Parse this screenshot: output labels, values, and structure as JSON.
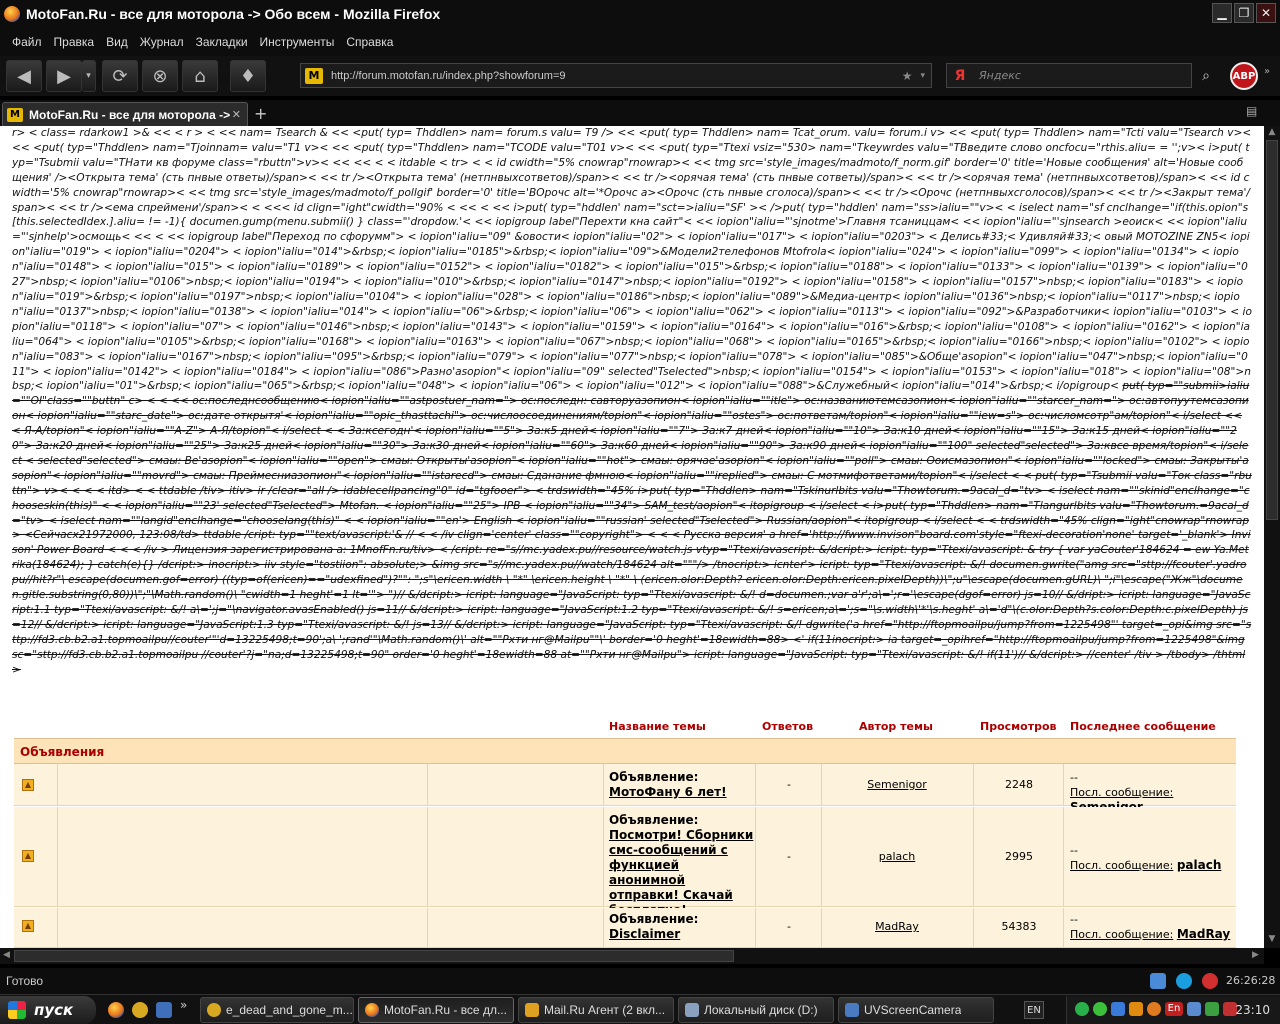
{
  "window": {
    "title": "MotoFan.Ru - все для моторола -> Обо всем - Mozilla Firefox",
    "min_glyph": "▁",
    "max_glyph": "❐",
    "close_glyph": "✕"
  },
  "menu": [
    "Файл",
    "Правка",
    "Вид",
    "Журнал",
    "Закладки",
    "Инструменты",
    "Справка"
  ],
  "toolbar": {
    "back_glyph": "◀",
    "forward_glyph": "▶",
    "history_glyph": "▾",
    "reload_glyph": "⟳",
    "stop_glyph": "⊗",
    "home_glyph": "⌂",
    "addon_glyph": "♦",
    "url": "http://forum.motofan.ru/index.php?showforum=9",
    "site_icon_letter": "M",
    "star_glyph": "★",
    "drop_glyph": "▾",
    "search_engine_letter": "Я",
    "search_placeholder": "Яндекс",
    "search_go_glyph": "⌕",
    "abp_label": "ABP",
    "overflow_glyph": "»"
  },
  "tabs": {
    "active_label": "MotoFan.Ru - все для моторола -> Об...",
    "close_glyph": "✕",
    "new_tab_glyph": "+",
    "list_glyph": "▤"
  },
  "garbage": {
    "plain": "r> < class= rdarkow1 >& << < r > < << nam= Tsearch & << <put( typ= Thddlen> nam= forum.s valu= T9 /> << <put( typ= Thddlen> nam= Tcat_orum. valu= forum.i v> << <put( typ= Thddlen> nam=\"Tcti valu=\"Tsearch v>< << <put( typ=\"Thddlen> nam=\"Tjoinnam= valu=\"T1 v>< << <put( typ=\"Thddlen> nam=\"TCODE valu=\"T01 v>< << <put( typ=\"Ttexi vsiz=\"530> nam=\"Tkeywrdes valu=\"TВведите слово oncfocu=\"rthis.aliu= = '';v>< i>put( typ=\"Tsubmii valu=\"TНати кв форуме class=\"rbuttn\">v>< << << < < itdable < tr> < < id cwidth=\"5% cnowrap\"rnowrap>< << tmg src='style_images/madmoto/f_norm.gif' border='0' title='Новые сообщения' alt='Новые сообщения' /><Открыта тема' (сть пнвые ответы)/span>< << tr /><Открыта тема' (нетпнвыхсответов)/span>< << tr /><орячая тема' (сть пнвые сответы)/span>< << tr /><орячая тема' (нетпнвыхсответов)/span>< << id cwidth='5% cnowrap\"rnowrap>< << tmg src='style_images/madmoto/f_pollgif' border='0' title='ВОрочс alt='*Орочс а><Орочс (сть пнвые сголоса)/span>< << tr /><Орочс (нетпнвыхсголосов)/span>< << tr /><Закрыт тема'/span>< << tr /><ема спреймени'/span>< < <<< id clign=\"ight\"cwidth=\"90% < << < << i>put( typ=\"hddlen' nam=\"sct=>ialiu=\"SF' >< />put( typ=\"hddlen' nam=\"ss>ialiu=\"\"v>< < iselect nam=\"sf cnclhange=\"if(this.opion\"s[this.selectedIdex.].aliu= != -1){ documen.gump(menu.submii() } class=\"'dropdow.'< << iopigroup label\"Перехти кна сайт\"< << iopion\"ialiu=\"'sjnotme'>Главня тсаниццам< << iopion\"ialiu=\"'sjnsearch >еоиск< << iopion\"ialiu=\"'sjnhelp'>осмощь< << < << iopigroup label\"Переход по сфорумм\"> < iopion\"ialiu=\"09\" &овости< iopion\"ialiu=\"02\"> < iopion\"ialiu=\"017\"> < iopion\"ialiu=\"0203\"> < Делись#33;< Удивляй#33;< овый MOTOZINE ZN5< iopion\"ialiu=\"019\"> < iopion\"ialiu=\"0204\"> < iopion\"ialiu=\"014\">&rbsp;< iopion\"ialiu=\"0185\">&rbsp;< iopion\"ialiu=\"09\">&Модели2телефонов Mtofrola< iopion\"ialiu=\"024\"> < iopion\"ialiu=\"099\"> < iopion\"ialiu=\"0134\"> < iopion\"ialiu=\"0148\"> < iopion\"ialiu=\"015\"> < iopion\"ialiu=\"0189\"> < iopion\"ialiu=\"0152\"> < iopion\"ialiu=\"0182\"> < iopion\"ialiu=\"015\">&rbsp;< iopion\"ialiu=\"0188\"> < iopion\"ialiu=\"0133\"> < iopion\"ialiu=\"0139\"> < iopion\"ialiu=\"027\">nbsp;< iopion\"ialiu=\"0106\">nbsp;< iopion\"ialiu=\"0194\"> < iopion\"ialiu=\"010\">&rbsp;< iopion\"ialiu=\"0147\">nbsp;< iopion\"ialiu=\"0192\"> < iopion\"ialiu=\"0158\"> < iopion\"ialiu=\"0157\">nbsp;< iopion\"ialiu=\"0183\"> < iopion\"ialiu=\"019\">&rbsp;< iopion\"ialiu=\"0197\">nbsp;< iopion\"ialiu=\"0104\"> < iopion\"ialiu=\"028\"> < iopion\"ialiu=\"0186\">nbsp;< iopion\"ialiu=\"089\">&Медиа-центр< iopion\"ialiu=\"0136\">nbsp;< iopion\"ialiu=\"0117\">nbsp;< iopion\"ialiu=\"0137\">nbsp;< iopion\"ialiu=\"0138\"> < iopion\"ialiu=\"014\"> < iopion\"ialiu=\"06\">&rbsp;< iopion\"ialiu=\"06\"> < iopion\"ialiu=\"062\"> < iopion\"ialiu=\"0113\"> < iopion\"ialiu=\"092\">&Разработчики< iopion\"ialiu=\"0103\"> < iopion\"ialiu=\"0118\"> < iopion\"ialiu=\"07\"> < iopion\"ialiu=\"0146\">nbsp;< iopion\"ialiu=\"0143\"> < iopion\"ialiu=\"0159\"> < iopion\"ialiu=\"0164\"> < iopion\"ialiu=\"016\">&rbsp;< iopion\"ialiu=\"0108\"> < iopion\"ialiu=\"0162\"> < iopion\"ialiu=\"064\"> < iopion\"ialiu=\"0105\">&rbsp;< iopion\"ialiu=\"0168\"> < iopion\"ialiu=\"0163\"> < iopion\"ialiu=\"067\">nbsp;< iopion\"ialiu=\"068\"> < iopion\"ialiu=\"0165\">&rbsp;< iopion\"ialiu=\"0166\">nbsp;< iopion\"ialiu=\"0102\"> < iopion\"ialiu=\"083\"> < iopion\"ialiu=\"0167\">nbsp;< iopion\"ialiu=\"095\">&rbsp;< iopion\"ialiu=\"079\"> < iopion\"ialiu=\"077\">nbsp;< iopion\"ialiu=\"078\"> < iopion\"ialiu=\"085\">&Обще'asopion\"< iopion\"ialiu=\"047\">nbsp;< iopion\"ialiu=\"011\"> < iopion\"ialiu=\"0142\"> < iopion\"ialiu=\"0184\"> < iopion\"ialiu=\"086\">Разно'asopion\"< iopion\"ialiu=\"09\" selected\"Tselected\">nbsp;< iopion\"ialiu=\"0154\"> < iopion\"ialiu=\"0153\"> < iopion\"ialiu=\"018\"> < iopion\"ialiu=\"08\">nbsp;< iopion\"ialiu=\"01\">&rbsp;< iopion\"ialiu=\"065\">&rbsp;< iopion\"ialiu=\"048\"> < iopion\"ialiu=\"06\"> < iopion\"ialiu=\"012\"> < iopion\"ialiu=\"088\">&Служебный< iopion\"ialiu=\"014\">&rbsp;< i/opigroup< ",
    "struck": "put( typ=\"\"submii>ialiu=\"\"OI\"class=\"\"buttn\" c> < < << ос:последнсообщению< iopion\"ialiu=\"\"astpostuer_nam=\"> ос:последн: савторуазопион< iopion\"ialiu=\"\"itle\"> ос:названиютемсазопион< iopion\"ialiu=\"\"starcer_nam=\"> ос:автопуутемсазопион< iopion\"ialiu=\"\"starc_date\"> ос:дате открытя'< iopion\"ialiu=\"\"opic_thasttachi\"> ос:числоосоединениям/topion\"< iopion\"ialiu=\"\"ostes\"> ос:пответам/topion\"< iopion\"ialiu=\"\"iew=s\"> ос:числомсотр\"ам/topion\"< i/select << < Я-А/topion\"< iopion\"ialiu=\"\"A-Z\"> А-Я/topion\"< i/select < < За:ксегодн'< iopion\"ialiu=\"\"5\"> За:к5 дней< iopion\"ialiu=\"\"7\"> За:к7 дней< iopion\"ialiu=\"\"10\"> За:к10 дней< iopion\"ialiu=\"\"15\"> За:к15 дней< iopion\"ialiu=\"\"20\"> За:к20 дней< iopion\"ialiu=\"\"25\"> За:к25 дней< iopion\"ialiu=\"\"30\"> За:к30 дней< iopion\"ialiu=\"\"60\"> За:к60 дней< iopion\"ialiu=\"\"90\"> За:к90 дней< iopion\"ialiu=\"\"100\" selected\"selected\"> За:квсе время/topion\"< i/select < selected\"selected\"> смаы: Ве'asopion\"< iopion\"ialiu=\"\"open\"> смаы: Открыты'asopion\"< iopion\"ialiu=\"\"hot\"> смаы: орячае'asopion\"< iopion\"ialiu=\"\"poll\"> смаы: Ооисмазопион\"< iopion\"ialiu=\"\"locked\"> смаы: Закрыты'asopion\"< iopion\"ialiu=\"\"movrd\"> смаы: Преймесниазопион\"< iopion\"ialiu=\"\"istarecd\"> смаы: Сданание фмною< iopion\"ialiu=\"\"ireplied\"> смаы: С мотмифответами/topion\"< i/select < < put( typ=\"Tsubmii valu=\"Ток class=\"rbuttn\"> v>< < < < itd> < < ttdable /tiv> itiv> ir /clear=\"all /> idablecellpancing\"0\" id=\"tgfooer\"> < trdswidth=\"45% i>put( typ=\"Thddlen> nam=\"Tskinurlbits valu=\"Thowtorum.=9acal_d=\"tv> < iselect nam=\"\"skinid\"enclhange=\"chooseskin(this)\" < < iopion\"ialiu=\"\"23' selected\"Tselected\"> Mtofan. < iopion\"ialiu=\"\"25\"> IPB < iopion\"ialiu=\"\"34\"> SAM_test/aopion\"< itopigroup < i/select < i>put( typ=\"Thddlen> nam=\"Tlangurlbits valu=\"Thowtorum.=9acal_d=\"tv> < iselect nam=\"\"langid\"enclhange=\"chooselang(this)\" < < iopion\"ialiu=\"\"en'> English < iopion\"ialiu=\"\"russian' selected\"Tselected\"> Russian/aopion\"< itopigroup < i/select < < trdswidth=\"45% clign=\"ight\"cnowrap\"rnowrap> <Сейчасх21972000, 123:08/td> ttdable /cript: typ=\"\"text/avascript:'& // < < /iv clign='center' class=\"\"copyright\"> < < < Русска версия' a href='http://fwww.invison\"board.com'style=\"ftexi-decoration'none' target='_blank'> Invison' Power Board < < < /iv > Лицензия зарегистрирована а: 1MnofFn.ru/tiv> < /cript: re=\"s//mc.yadex.pu//resource/watch.js vtyp=\"Ttexi/avascript: &/dcript:> icript: typ=\"Ttexi/avascript: & try { var yaCouter'184624 = ew Ya.Metrika(184624); } catch(e){} /dcript:> inocript:> iiv style=\"tostiion\": absolute;> &img src=\"s//mc.yadex.pu//watch/184624 alt=\"\"\"/> /tnocript:> icnter'> icript: typ=\"Ttexi/avascript: &/! documen.gwrite(\"amg src=\"sttp://fcouter'.yadropu//hit?r\"\\ escape(documen.gof=error) ((typ=of(ericen)==\"udexfined\")?\"\": \";s\"\\ericen.width \\ \"*\" \\ericen.height \\ \"*\" \\ (ericen.olor:Depth? ericen.olor:Depth:ericen.pixelDepth))\\\";u\"\\escape(documen.gURL)\\ \";i\"\\escape(\"Жж\"\\documen.gitle.substring(0,80))\\\";\"\\Math.random()\\ \"cwidth=1 heght'=1 lt='\"> \")//  &/dcript:> icript: language=\"JavaScript: typ=\"Ttexi/avascript: &/! d=documen.;var a'r';a\\=';r='\\escape(dgof=error) js=10//  &/dript:> icript: language=\"JavaScript:1.1 typ=\"Ttexi/avascript: &/! a\\=';j=\"\\navigator.avasEnabled() js=11//  &/dcript:> icript: language=\"JavaScript:1.2 typ=\"Ttexi/avascript: &/! s=ericen;a\\=';s=\"\\s.width\\'*'\\s.heght' a\\='d\"\\(c.olor:Depth?s.color:Depth:c.pixelDepth) js=12//  &/dcript:> icript: language=\"JavaScript:1.3 typ=\"Ttexi/avascript: &/! js=13//  &/dcript:> icript: language=\"JavaScript: typ=\"Ttexi/avascript: &/! dgwrite('a href=\"http://ftopmoailpu/jump?from=1225498\"' target=_opi&img src=\"sttp://fd3.cb.b2.a1.topmoailpu//couter'\"'d=13225498;t=90';a\\ ';rand'\"\\Math.random()\\' alt=\"\"Рхти нг@Mailpu\"\"\\' border='0 heght'=18ewidth=88> <' if(11inocript:> ia target=_opihref=\"http://ftopmoailpu/jump?from=1225498\"&img sc=\"sttp://fd3.cb.b2.a1.topmoailpu //couter'?j=\"na;d=13225498;t=90\" order='0 heght'=18ewidth=88 at=\"\"Рхти нг@Mailpu\"> icript: language=\"JavaScript: typ=\"Ttexi/avascript: &/! if(11')//  &/dcript:> //center' /tiv > /tbody> /thtml>"
  },
  "forum": {
    "headers": {
      "topic": "Название темы",
      "replies": "Ответов",
      "author": "Автор темы",
      "views": "Просмотров",
      "last": "Последнее сообщение"
    },
    "section_title": "Объявления",
    "icon_glyph": "▲",
    "rows": [
      {
        "prefix": "Объявление:",
        "title": "МотоФану 6 лет!",
        "replies": "-",
        "author": "Semenigor",
        "views": "2248",
        "last_dash": "--",
        "last_label": "Посл. сообщение:",
        "last_author": "Semenigor"
      },
      {
        "prefix": "Объявление:",
        "title": "Посмотри! Сборники смс-сообщений с функцией анонимной отправки! Скачай бесплатно!",
        "replies": "-",
        "author": "palach",
        "views": "2995",
        "last_dash": "--",
        "last_label": "Посл. сообщение:",
        "last_author": "palach"
      },
      {
        "prefix": "Объявление:",
        "title": "Disclaimer",
        "replies": "-",
        "author": "MadRay",
        "views": "54383",
        "last_dash": "--",
        "last_label": "Посл. сообщение:",
        "last_author": "MadRay"
      }
    ]
  },
  "scroll": {
    "up_glyph": "▲",
    "down_glyph": "▼",
    "left_glyph": "◀",
    "right_glyph": "▶"
  },
  "status": {
    "text": "Готово",
    "clock": "26:26:28"
  },
  "taskbar": {
    "start_label": "пуск",
    "overflow_glyph": "»",
    "tasks": [
      "e_dead_and_gone_m...",
      "MotoFan.Ru - все дл...",
      "Mail.Ru Агент (2 вкл...",
      "Локальный диск (D:)",
      "UVScreenCamera"
    ],
    "lang": "EN",
    "tray_lang": "En",
    "clock": "23:10"
  }
}
